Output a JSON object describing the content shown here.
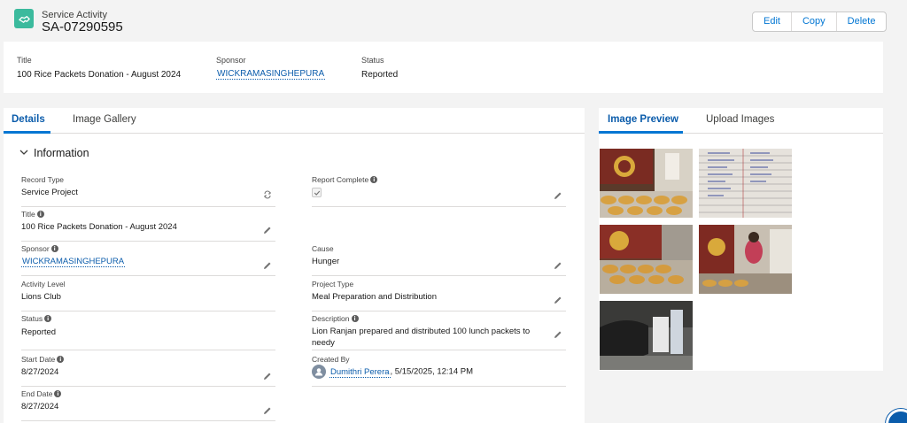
{
  "header": {
    "object_type": "Service Activity",
    "record_name": "SA-07290595",
    "icon": "handshake-icon",
    "actions": {
      "edit": "Edit",
      "copy": "Copy",
      "delete": "Delete"
    }
  },
  "highlights": {
    "title": {
      "label": "Title",
      "value": "100 Rice Packets Donation - August 2024"
    },
    "sponsor": {
      "label": "Sponsor",
      "value": "WICKRAMASINGHEPURA"
    },
    "status": {
      "label": "Status",
      "value": "Reported"
    }
  },
  "details": {
    "tabs": {
      "details": "Details",
      "gallery": "Image Gallery"
    },
    "section_title": "Information",
    "fields": {
      "record_type": {
        "label": "Record Type",
        "value": "Service Project"
      },
      "report_complete": {
        "label": "Report Complete",
        "checked": true
      },
      "title": {
        "label": "Title",
        "value": "100 Rice Packets Donation - August 2024"
      },
      "sponsor": {
        "label": "Sponsor",
        "value": "WICKRAMASINGHEPURA"
      },
      "cause": {
        "label": "Cause",
        "value": "Hunger"
      },
      "activity_level": {
        "label": "Activity Level",
        "value": "Lions Club"
      },
      "project_type": {
        "label": "Project Type",
        "value": "Meal Preparation and Distribution"
      },
      "status": {
        "label": "Status",
        "value": "Reported"
      },
      "description": {
        "label": "Description",
        "value": "Lion Ranjan prepared and distributed 100 lunch packets to needy"
      },
      "start_date": {
        "label": "Start Date",
        "value": "8/27/2024"
      },
      "created_by": {
        "label": "Created By",
        "name": "Dumithri Perera",
        "timestamp": ", 5/15/2025, 12:14 PM"
      },
      "end_date": {
        "label": "End Date",
        "value": "8/27/2024"
      }
    }
  },
  "image_panel": {
    "tabs": {
      "preview": "Image Preview",
      "upload": "Upload Images"
    },
    "image_count": 5
  },
  "colors": {
    "accent": "#0176d3",
    "link": "#0b5cab",
    "object_icon": "#3bba9d",
    "page_bg": "#f3f3f3"
  }
}
